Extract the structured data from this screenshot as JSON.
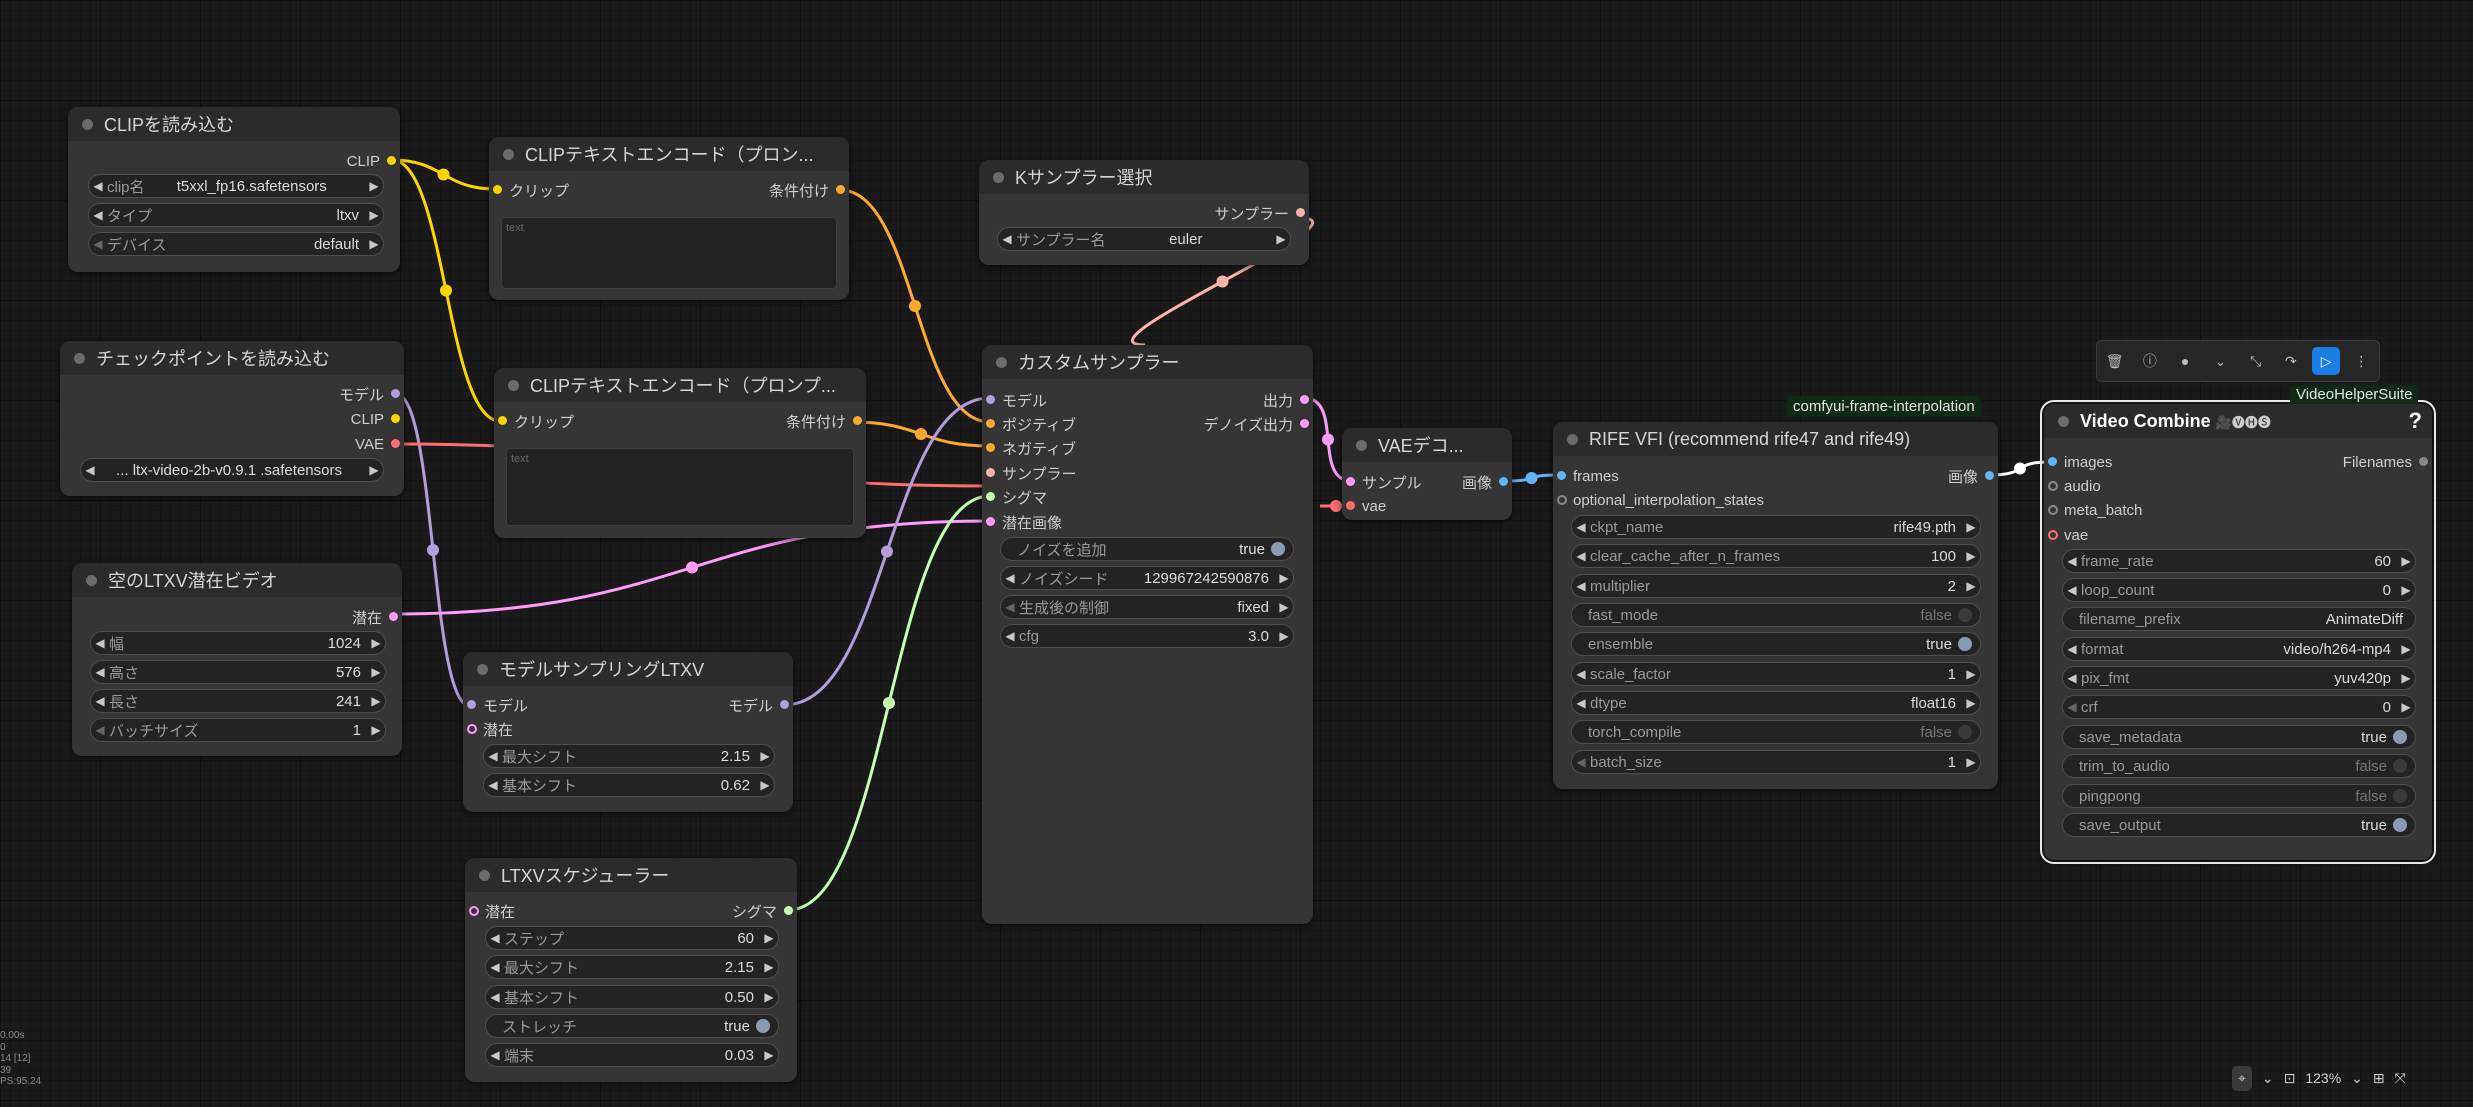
{
  "stats": [
    "0.00s",
    "0",
    "14 [12]",
    "39",
    "PS:95.24"
  ],
  "toolbar": {
    "icons": [
      "trash-icon",
      "info-icon",
      "color-icon",
      "chevron-down-icon",
      "fit-icon",
      "redo-icon",
      "run-icon",
      "more-icon"
    ],
    "glyphs": [
      "🗑",
      "ⓘ",
      "●",
      "⌄",
      "⤡",
      "↷",
      "▷",
      "⋮"
    ]
  },
  "bottom": {
    "zoom": "123%",
    "glyphs": [
      "⌖",
      "⌄",
      "⊡",
      "123%",
      "⌄",
      "⊞",
      "⤧"
    ]
  },
  "badges": {
    "rife_pack": "comfyui-frame-interpolation",
    "vhs_pack": "VideoHelperSuite"
  },
  "nodes": {
    "clip_loader": {
      "title": "CLIPを読み込む",
      "out_clip": "CLIP",
      "widgets": [
        {
          "label": "clip名",
          "value": "t5xxl_fp16.safetensors"
        },
        {
          "label": "タイプ",
          "value": "ltxv"
        },
        {
          "label": "デバイス",
          "value": "default"
        }
      ]
    },
    "text_encode_1": {
      "title": "CLIPテキストエンコード（プロン...",
      "in_clip": "クリップ",
      "out": "条件付け",
      "placeholder": "text"
    },
    "text_encode_2": {
      "title": "CLIPテキストエンコード（プロンプ...",
      "in_clip": "クリップ",
      "out": "条件付け",
      "placeholder": "text"
    },
    "ckpt_loader": {
      "title": "チェックポイントを読み込む",
      "out_model": "モデル",
      "out_clip": "CLIP",
      "out_vae": "VAE",
      "widgets": [
        {
          "label": "",
          "value": "... ltx-video-2b-v0.9.1 .safetensors"
        }
      ]
    },
    "empty_latent": {
      "title": "空のLTXV潜在ビデオ",
      "out": "潜在",
      "widgets": [
        {
          "label": "幅",
          "value": "1024"
        },
        {
          "label": "高さ",
          "value": "576"
        },
        {
          "label": "長さ",
          "value": "241"
        },
        {
          "label": "バッチサイズ",
          "value": "1"
        }
      ]
    },
    "model_sampling": {
      "title": "モデルサンプリングLTXV",
      "in_model": "モデル",
      "in_latent": "潜在",
      "out_model": "モデル",
      "widgets": [
        {
          "label": "最大シフト",
          "value": "2.15"
        },
        {
          "label": "基本シフト",
          "value": "0.62"
        }
      ]
    },
    "scheduler": {
      "title": "LTXVスケジューラー",
      "in_latent": "潜在",
      "out": "シグマ",
      "widgets": [
        {
          "label": "ステップ",
          "value": "60"
        },
        {
          "label": "最大シフト",
          "value": "2.15"
        },
        {
          "label": "基本シフト",
          "value": "0.50"
        },
        {
          "label": "ストレッチ",
          "value": "true"
        },
        {
          "label": "端末",
          "value": "0.03"
        }
      ]
    },
    "ksampler_select": {
      "title": "Kサンプラー選択",
      "out": "サンプラー",
      "widgets": [
        {
          "label": "サンプラー名",
          "value": "euler"
        }
      ]
    },
    "custom_sampler": {
      "title": "カスタムサンプラー",
      "inputs": [
        "モデル",
        "ポジティブ",
        "ネガティブ",
        "サンプラー",
        "シグマ",
        "潜在画像"
      ],
      "outputs": [
        "出力",
        "デノイズ出力"
      ],
      "widgets": [
        {
          "label": "ノイズを追加",
          "value": "true"
        },
        {
          "label": "ノイズシード",
          "value": "129967242590876"
        },
        {
          "label": "生成後の制御",
          "value": "fixed"
        },
        {
          "label": "cfg",
          "value": "3.0"
        }
      ]
    },
    "vae_decode": {
      "title": "VAEデコ...",
      "in_samples": "サンプル",
      "in_vae": "vae",
      "out": "画像"
    },
    "rife": {
      "title": "RIFE VFI (recommend rife47 and rife49)",
      "in_frames": "frames",
      "in_opt": "optional_interpolation_states",
      "out": "画像",
      "widgets": [
        {
          "label": "ckpt_name",
          "value": "rife49.pth"
        },
        {
          "label": "clear_cache_after_n_frames",
          "value": "100"
        },
        {
          "label": "multiplier",
          "value": "2"
        },
        {
          "label": "fast_mode",
          "value": "false"
        },
        {
          "label": "ensemble",
          "value": "true"
        },
        {
          "label": "scale_factor",
          "value": "1"
        },
        {
          "label": "dtype",
          "value": "float16"
        },
        {
          "label": "torch_compile",
          "value": "false"
        },
        {
          "label": "batch_size",
          "value": "1"
        }
      ]
    },
    "video_combine": {
      "title": "Video Combine",
      "emoji": "🎥🅥🅗🅢",
      "help": "?",
      "inputs": [
        "images",
        "audio",
        "meta_batch",
        "vae"
      ],
      "out": "Filenames",
      "widgets": [
        {
          "label": "frame_rate",
          "value": "60"
        },
        {
          "label": "loop_count",
          "value": "0"
        },
        {
          "label": "filename_prefix",
          "value": "AnimateDiff"
        },
        {
          "label": "format",
          "value": "video/h264-mp4"
        },
        {
          "label": "pix_fmt",
          "value": "yuv420p"
        },
        {
          "label": "crf",
          "value": "0"
        },
        {
          "label": "save_metadata",
          "value": "true"
        },
        {
          "label": "trim_to_audio",
          "value": "false"
        },
        {
          "label": "pingpong",
          "value": "false"
        },
        {
          "label": "save_output",
          "value": "true"
        }
      ]
    }
  },
  "colors": {
    "clip": "#ffd500",
    "cond": "#ffa931",
    "model": "#b39ddb",
    "vae": "#ff6e6e",
    "latent": "#ff9cf9",
    "sampler": "#ffb3a8",
    "sigmas": "#c2ffae",
    "image": "#64b5f6",
    "toggle_on": "#8a9ab0",
    "toggle_off": "#3a3a3a"
  }
}
